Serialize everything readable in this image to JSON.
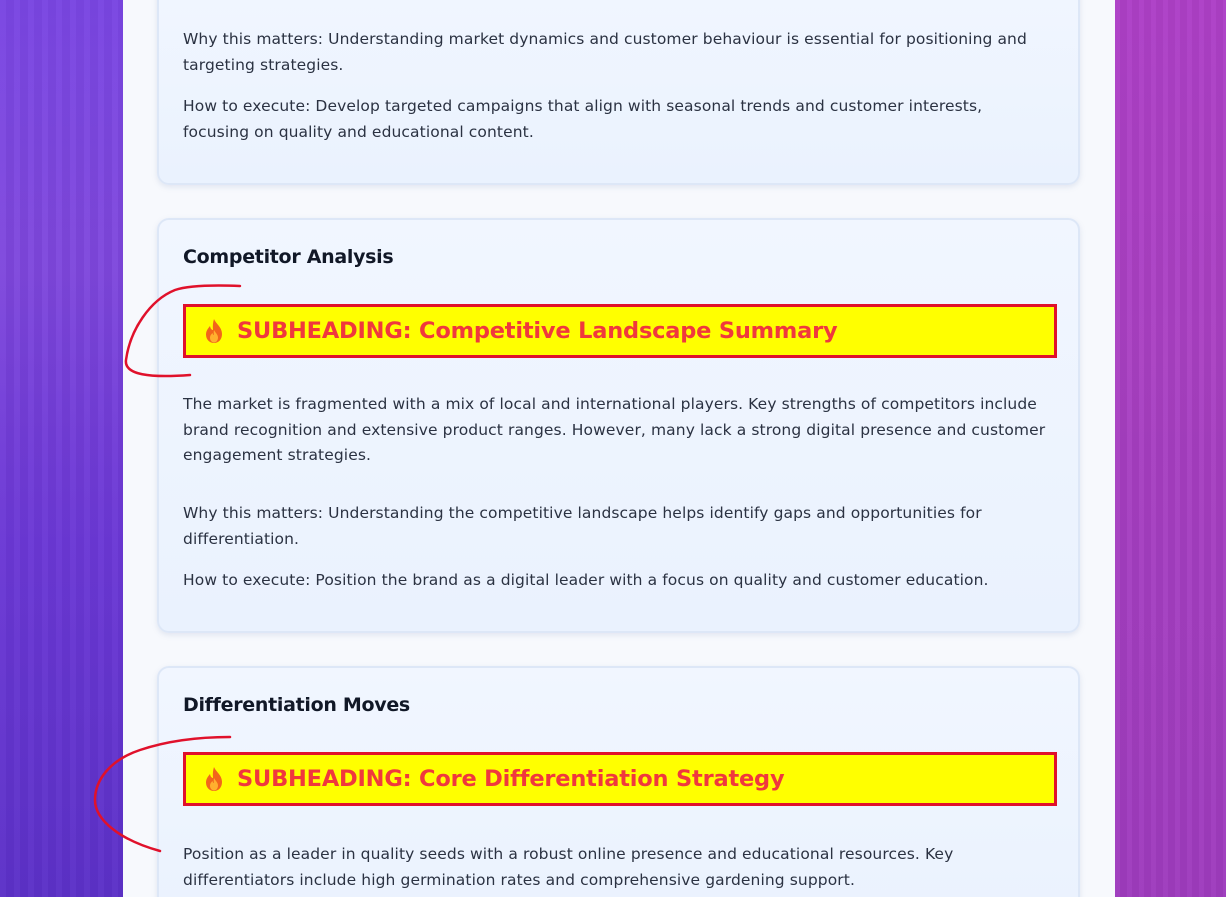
{
  "sections": [
    {
      "why": "Why this matters: Understanding market dynamics and customer behaviour is essential for positioning and targeting strategies.",
      "how": "How to execute: Develop targeted campaigns that align with seasonal trends and customer interests, focusing on quality and educational content."
    },
    {
      "title": "Competitor Analysis",
      "subheading": "SUBHEADING: Competitive Landscape Summary",
      "body": "The market is fragmented with a mix of local and international players. Key strengths of competitors include brand recognition and extensive product ranges. However, many lack a strong digital presence and customer engagement strategies.",
      "why": "Why this matters: Understanding the competitive landscape helps identify gaps and opportunities for differentiation.",
      "how": "How to execute: Position the brand as a digital leader with a focus on quality and customer education."
    },
    {
      "title": "Differentiation Moves",
      "subheading": "SUBHEADING: Core Differentiation Strategy",
      "body": "Position as a leader in quality seeds with a robust online presence and educational resources. Key differentiators include high germination rates and comprehensive gardening support."
    }
  ],
  "icons": {
    "subheading_icon": "fire-icon"
  },
  "colors": {
    "subheading_bg": "#ffff00",
    "subheading_border": "#e0112b",
    "subheading_text": "#f0383d",
    "annotation_stroke": "#e0112b"
  }
}
